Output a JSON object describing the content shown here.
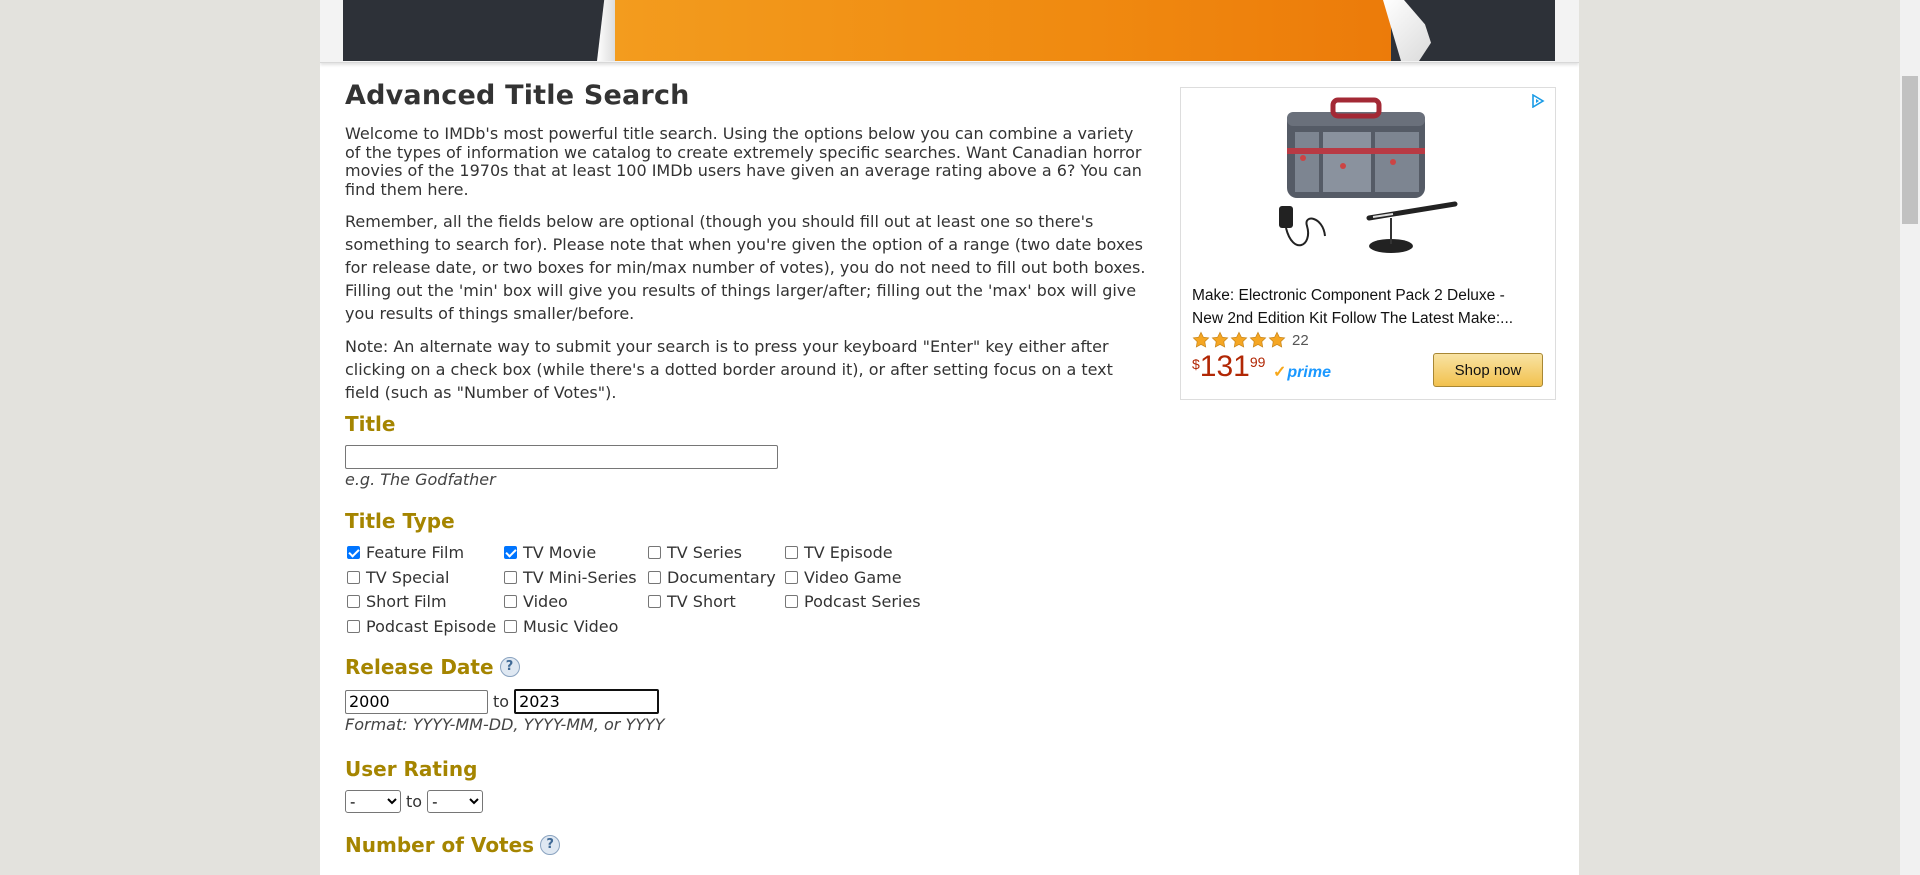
{
  "page": {
    "title": "Advanced Title Search",
    "intro": "Welcome to IMDb's most powerful title search. Using the options below you can combine a variety of the types of information we catalog to create extremely specific searches. Want Canadian horror movies of the 1970s that at least 100 IMDb users have given an average rating above a 6? You can find them here.",
    "remember": "Remember, all the fields below are optional (though you should fill out at least one so there's something to search for). Please note that when you're given the option of a range (two date boxes for release date, or two boxes for min/max number of votes), you do not need to fill out both boxes. Filling out the 'min' box will give you results of things larger/after; filling out the 'max' box will give you results of things smaller/before.",
    "note": "Note: An alternate way to submit your search is to press your keyboard \"Enter\" key either after clicking on a check box (while there's a dotted border around it), or after setting focus on a text field (such as \"Number of Votes\")."
  },
  "title_section": {
    "heading": "Title",
    "value": "",
    "hint_prefix": "e.g. ",
    "hint_example": "The Godfather"
  },
  "title_type": {
    "heading": "Title Type",
    "options": [
      {
        "label": "Feature Film",
        "checked": true
      },
      {
        "label": "TV Movie",
        "checked": true
      },
      {
        "label": "TV Series",
        "checked": false
      },
      {
        "label": "TV Episode",
        "checked": false
      },
      {
        "label": "TV Special",
        "checked": false
      },
      {
        "label": "TV Mini-Series",
        "checked": false
      },
      {
        "label": "Documentary",
        "checked": false
      },
      {
        "label": "Video Game",
        "checked": false
      },
      {
        "label": "Short Film",
        "checked": false
      },
      {
        "label": "Video",
        "checked": false
      },
      {
        "label": "TV Short",
        "checked": false
      },
      {
        "label": "Podcast Series",
        "checked": false
      },
      {
        "label": "Podcast Episode",
        "checked": false
      },
      {
        "label": "Music Video",
        "checked": false
      }
    ]
  },
  "release_date": {
    "heading": "Release Date",
    "help": "?",
    "from": "2000",
    "to_label": "to",
    "to": "2023",
    "format_hint": "Format: YYYY-MM-DD, YYYY-MM, or YYYY"
  },
  "user_rating": {
    "heading": "User Rating",
    "min": "-",
    "to_label": "to",
    "max": "-"
  },
  "number_of_votes": {
    "heading": "Number of Votes",
    "help": "?"
  },
  "ad": {
    "title": "Make: Electronic Component Pack 2 Deluxe - New 2nd Edition Kit Follow The Latest Make:...",
    "rating_stars": 5,
    "rating_count": "22",
    "price_currency": "$",
    "price_whole": "131",
    "price_fraction": "99",
    "prime": "prime",
    "button": "Shop now"
  }
}
